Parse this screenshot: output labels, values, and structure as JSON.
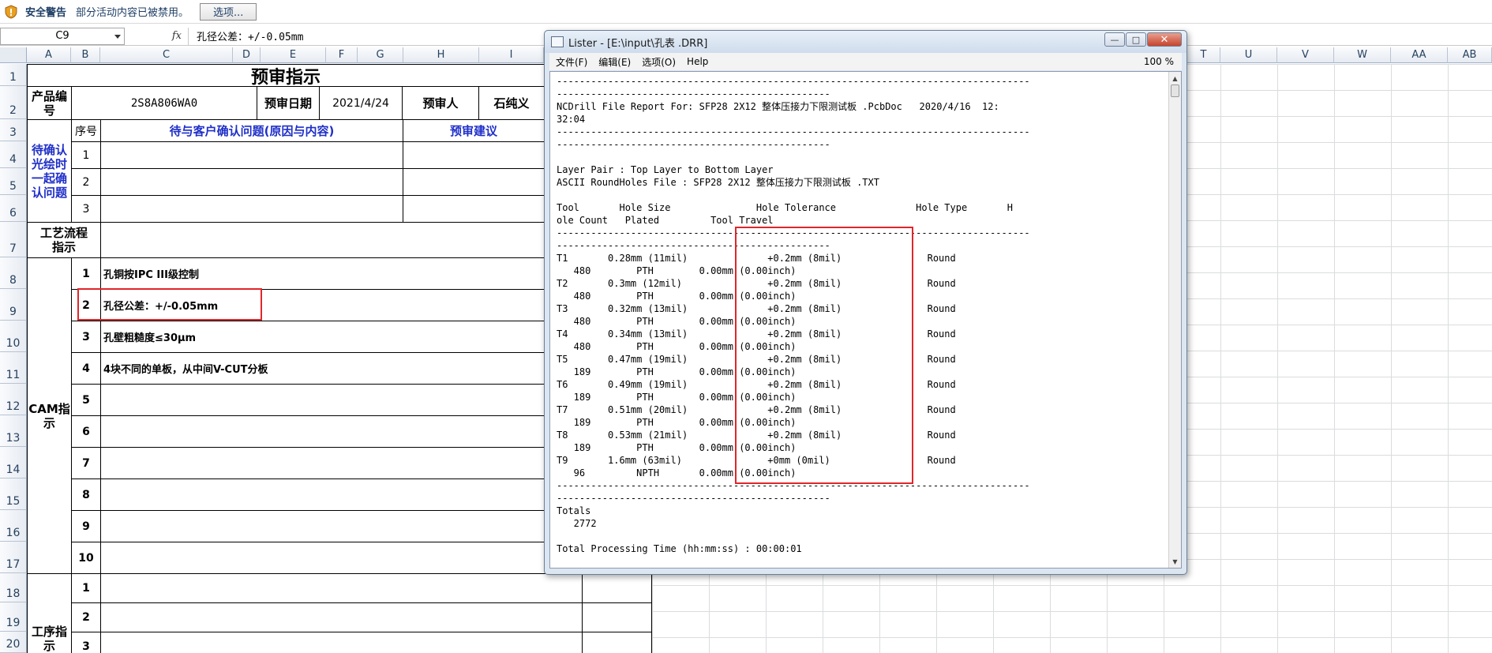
{
  "security_bar": {
    "title": "安全警告",
    "message": "部分活动内容已被禁用。",
    "options_button": "选项..."
  },
  "formula_bar": {
    "name_box": "C9",
    "fx": "fx",
    "formula": "孔径公差：+/-0.05mm"
  },
  "columns": [
    "A",
    "B",
    "C",
    "D",
    "E",
    "F",
    "G",
    "H",
    "I",
    "T",
    "U",
    "V",
    "W",
    "AA",
    "AB"
  ],
  "rows": [
    "1",
    "2",
    "3",
    "4",
    "5",
    "6",
    "7",
    "8",
    "9",
    "10",
    "11",
    "12",
    "13",
    "14",
    "15",
    "16",
    "17",
    "18",
    "19",
    "20"
  ],
  "sheet": {
    "title": "预审指示",
    "product_no_label": "产品编号",
    "product_no": "2S8A806WA0",
    "review_date_label": "预审日期",
    "review_date": "2021/4/24",
    "reviewer_label": "预审人",
    "reviewer": "石纯义",
    "seq_label": "序号",
    "issue_header": "待与客户确认问题(原因与内容)",
    "suggestion_header": "预审建议",
    "pending_label": "待确认光绘时一起确认问题",
    "pending_nums": [
      "1",
      "2",
      "3"
    ],
    "process_label": "工艺流程指示",
    "cam_label": "CAM指示",
    "cam_nums": [
      "1",
      "2",
      "3",
      "4",
      "5",
      "6",
      "7",
      "8",
      "9",
      "10"
    ],
    "cam_items": [
      "孔铜按IPC III级控制",
      "孔径公差：+/-0.05mm",
      "孔壁粗糙度≤30μm",
      "4块不同的单板，从中间V-CUT分板",
      "",
      "",
      "",
      "",
      "",
      ""
    ],
    "proc_label": "工序指示",
    "proc_nums": [
      "1",
      "2",
      "3"
    ]
  },
  "lister": {
    "title": "Lister - [E:\\input\\孔表 .DRR]",
    "menu": [
      "文件(F)",
      "编辑(E)",
      "选项(O)",
      "Help"
    ],
    "zoom": "100 %",
    "lines": [
      "-----------------------------------------------------------------------------------",
      "------------------------------------------------",
      "NCDrill File Report For: SFP28 2X12 整体压接力下限测试板 .PcbDoc   2020/4/16  12:",
      "32:04",
      "-----------------------------------------------------------------------------------",
      "------------------------------------------------",
      "",
      "Layer Pair : Top Layer to Bottom Layer",
      "ASCII RoundHoles File : SFP28 2X12 整体压接力下限测试板 .TXT",
      "",
      "Tool       Hole Size               Hole Tolerance              Hole Type       H",
      "ole Count   Plated         Tool Travel",
      "-----------------------------------------------------------------------------------",
      "------------------------------------------------",
      "T1       0.28mm (11mil)              +0.2mm (8mil)               Round",
      "   480        PTH        0.00mm (0.00inch)",
      "T2       0.3mm (12mil)               +0.2mm (8mil)               Round",
      "   480        PTH        0.00mm (0.00inch)",
      "T3       0.32mm (13mil)              +0.2mm (8mil)               Round",
      "   480        PTH        0.00mm (0.00inch)",
      "T4       0.34mm (13mil)              +0.2mm (8mil)               Round",
      "   480        PTH        0.00mm (0.00inch)",
      "T5       0.47mm (19mil)              +0.2mm (8mil)               Round",
      "   189        PTH        0.00mm (0.00inch)",
      "T6       0.49mm (19mil)              +0.2mm (8mil)               Round",
      "   189        PTH        0.00mm (0.00inch)",
      "T7       0.51mm (20mil)              +0.2mm (8mil)               Round",
      "   189        PTH        0.00mm (0.00inch)",
      "T8       0.53mm (21mil)              +0.2mm (8mil)               Round",
      "   189        PTH        0.00mm (0.00inch)",
      "T9       1.6mm (63mil)               +0mm (0mil)                 Round",
      "   96         NPTH       0.00mm (0.00inch)",
      "-----------------------------------------------------------------------------------",
      "------------------------------------------------",
      "Totals",
      "   2772",
      "",
      "Total Processing Time (hh:mm:ss) : 00:00:01"
    ]
  }
}
